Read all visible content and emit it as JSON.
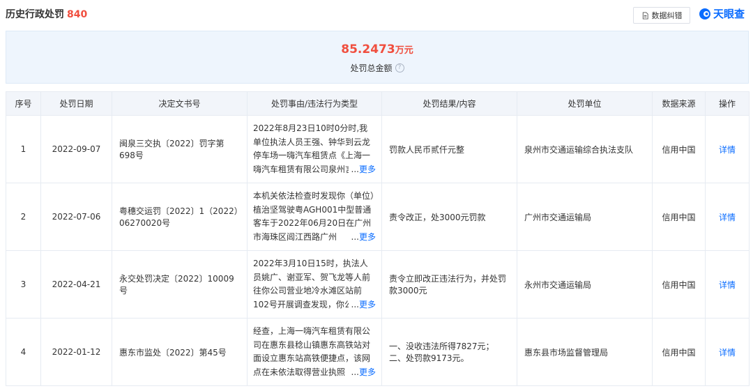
{
  "header": {
    "title": "历史行政处罚",
    "count": "840",
    "correct_button": "数据纠错",
    "brand": "天眼查"
  },
  "summary": {
    "amount": "85.2473",
    "unit": "万元",
    "label": "处罚总金额",
    "help": "?"
  },
  "table": {
    "columns": [
      "序号",
      "处罚日期",
      "决定文书号",
      "处罚事由/违法行为类型",
      "处罚结果/内容",
      "处罚单位",
      "数据来源",
      "操作"
    ],
    "more_prefix": "...",
    "more_label": "更多",
    "rows": [
      {
        "no": "1",
        "date": "2022-09-07",
        "doc": "闽泉三交执〔2022〕罚字第698号",
        "reason": "2022年8月23日10时0分时,我单位执法人员王强、钟华到云龙停车场一嗨汽车租赁点《上海一嗨汽车租赁有限公司泉州言",
        "result": "罚款人民币贰仟元整",
        "unit": "泉州市交通运输综合执法支队",
        "source": "信用中国",
        "action": "详情"
      },
      {
        "no": "2",
        "date": "2022-07-06",
        "doc": "粤穗交运罚〔2022〕1（2022）06270020号",
        "reason": "本机关依法检查时发现你（单位）植治坚驾驶粤AGH001中型普通客车于2022年06月20日在广州市海珠区阊江西路广州",
        "result": "责令改正，处3000元罚款",
        "unit": "广州市交通运输局",
        "source": "信用中国",
        "action": "详情"
      },
      {
        "no": "3",
        "date": "2022-04-21",
        "doc": "永交处罚决定〔2022〕10009号",
        "reason": "2022年3月10日15时，执法人员姚广、谢亚军、贺飞龙等人前往你公司营业地冷水滩区站前102号开展调查发现，你公司",
        "result": "责令立即改正违法行为，并处罚款3000元",
        "unit": "永州市交通运输局",
        "source": "信用中国",
        "action": "详情"
      },
      {
        "no": "4",
        "date": "2022-01-12",
        "doc": "惠东市监处〔2022〕第45号",
        "reason": "经查，上海一嗨汽车租赁有限公司在惠东县稔山镇惠东高铁站对面设立惠东站高铁便捷点，该网点在未依法取得营业执照",
        "result": "一、没收违法所得7827元；二、处罚款9173元。",
        "unit": "惠东县市场监督管理局",
        "source": "信用中国",
        "action": "详情"
      }
    ]
  }
}
